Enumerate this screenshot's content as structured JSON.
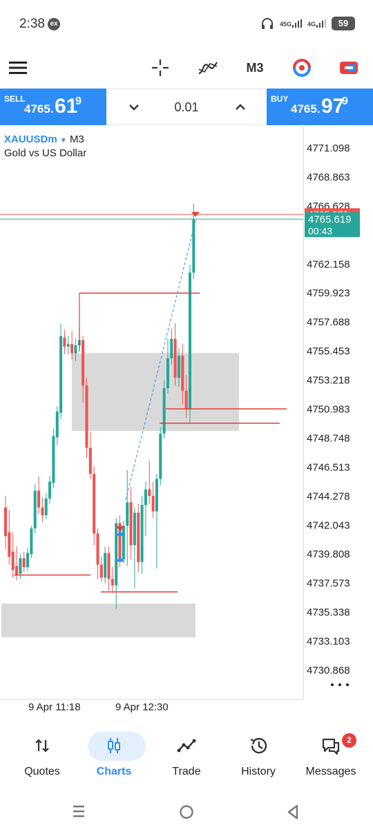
{
  "status_bar": {
    "time": "2:38",
    "ex_badge": "ex",
    "signal_1": "45G",
    "signal_2": "4G",
    "battery": "59"
  },
  "toolbar": {
    "timeframe": "M3",
    "icons": [
      "menu-icon",
      "crosshair-icon",
      "indicators-icon",
      "timeframe-label",
      "one-click-trading-icon",
      "chart-settings-icon"
    ]
  },
  "trade": {
    "sell_label": "SELL",
    "sell_price_small": "4765.",
    "sell_price_big": "61",
    "sell_price_sup": "9",
    "buy_label": "BUY",
    "buy_price_small": "4765.",
    "buy_price_big": "97",
    "buy_price_sup": "9",
    "lot": "0.01"
  },
  "chart": {
    "symbol": "XAUUSDm",
    "timeframe": "M3",
    "description": "Gold vs US Dollar",
    "current_price": "4765.619",
    "countdown": "00:43",
    "ask_price_partial": "4765.979",
    "colors": {
      "bull": "#26a69a",
      "bear": "#ef5350",
      "level": "#e53935",
      "zone": "#d9d9d9",
      "bid_label": "#26a69a",
      "ask_label": "#ef5350",
      "trend": "#2d8cf5"
    },
    "time_labels": [
      "9 Apr 11:18",
      "9 Apr 12:30"
    ]
  },
  "chart_data": {
    "type": "candlestick",
    "symbol": "XAUUSDm",
    "price_axis_ticks": [
      "4771.098",
      "4768.863",
      "4766.628",
      "4762.158",
      "4759.923",
      "4757.688",
      "4755.453",
      "4753.218",
      "4750.983",
      "4748.748",
      "4746.513",
      "4744.278",
      "4742.043",
      "4739.808",
      "4737.573",
      "4735.338",
      "4733.103",
      "4730.868"
    ],
    "ylim": [
      4730.868,
      4771.098
    ],
    "x_labels": [
      "9 Apr 11:18",
      "9 Apr 12:30"
    ],
    "last_price": 4765.619,
    "ask_price": 4765.979,
    "candles": [
      {
        "o": 4743.4,
        "h": 4744.3,
        "c": 4741.2,
        "l": 4740.2
      },
      {
        "o": 4741.5,
        "h": 4743.2,
        "c": 4739.6,
        "l": 4739.0
      },
      {
        "o": 4740.0,
        "h": 4741.5,
        "c": 4738.6,
        "l": 4738.0
      },
      {
        "o": 4738.9,
        "h": 4740.4,
        "c": 4738.2,
        "l": 4737.8
      },
      {
        "o": 4738.3,
        "h": 4739.8,
        "c": 4739.5,
        "l": 4737.9
      },
      {
        "o": 4739.5,
        "h": 4740.0,
        "c": 4738.8,
        "l": 4738.4
      },
      {
        "o": 4738.8,
        "h": 4740.3,
        "c": 4739.9,
        "l": 4738.5
      },
      {
        "o": 4739.8,
        "h": 4742.0,
        "c": 4741.8,
        "l": 4739.5
      },
      {
        "o": 4741.8,
        "h": 4745.2,
        "c": 4744.7,
        "l": 4741.4
      },
      {
        "o": 4744.7,
        "h": 4745.8,
        "c": 4743.4,
        "l": 4742.9
      },
      {
        "o": 4743.4,
        "h": 4744.2,
        "c": 4742.8,
        "l": 4742.3
      },
      {
        "o": 4742.8,
        "h": 4744.5,
        "c": 4744.1,
        "l": 4742.5
      },
      {
        "o": 4744.1,
        "h": 4745.8,
        "c": 4745.4,
        "l": 4743.7
      },
      {
        "o": 4745.3,
        "h": 4749.5,
        "c": 4748.9,
        "l": 4744.9
      },
      {
        "o": 4748.8,
        "h": 4751.2,
        "c": 4750.8,
        "l": 4748.2
      },
      {
        "o": 4750.7,
        "h": 4757.6,
        "c": 4756.6,
        "l": 4750.2
      },
      {
        "o": 4756.5,
        "h": 4757.1,
        "c": 4755.8,
        "l": 4755.2
      },
      {
        "o": 4755.8,
        "h": 4756.6,
        "c": 4756.0,
        "l": 4755.2
      },
      {
        "o": 4756.0,
        "h": 4757.0,
        "c": 4755.3,
        "l": 4754.8
      },
      {
        "o": 4755.3,
        "h": 4756.4,
        "c": 4755.9,
        "l": 4754.7
      },
      {
        "o": 4755.9,
        "h": 4757.3,
        "c": 4756.3,
        "l": 4755.4
      },
      {
        "o": 4756.3,
        "h": 4756.6,
        "c": 4752.8,
        "l": 4751.5
      },
      {
        "o": 4752.8,
        "h": 4753.4,
        "c": 4748.0,
        "l": 4747.2
      },
      {
        "o": 4748.0,
        "h": 4749.2,
        "c": 4746.0,
        "l": 4745.6
      },
      {
        "o": 4746.0,
        "h": 4746.6,
        "c": 4741.4,
        "l": 4740.5
      },
      {
        "o": 4741.4,
        "h": 4741.8,
        "c": 4739.0,
        "l": 4737.9
      },
      {
        "o": 4739.0,
        "h": 4739.6,
        "c": 4738.0,
        "l": 4737.7
      },
      {
        "o": 4738.0,
        "h": 4740.4,
        "c": 4739.9,
        "l": 4737.6
      },
      {
        "o": 4739.9,
        "h": 4740.4,
        "c": 4737.9,
        "l": 4737.0
      },
      {
        "o": 4737.9,
        "h": 4738.8,
        "c": 4737.4,
        "l": 4736.8
      },
      {
        "o": 4737.4,
        "h": 4742.6,
        "c": 4742.2,
        "l": 4735.6
      },
      {
        "o": 4742.2,
        "h": 4742.8,
        "c": 4739.4,
        "l": 4738.8
      },
      {
        "o": 4739.4,
        "h": 4742.4,
        "c": 4742.0,
        "l": 4739.1
      },
      {
        "o": 4742.0,
        "h": 4746.3,
        "c": 4743.8,
        "l": 4738.9
      },
      {
        "o": 4743.8,
        "h": 4745.0,
        "c": 4740.5,
        "l": 4739.4
      },
      {
        "o": 4740.5,
        "h": 4743.4,
        "c": 4743.0,
        "l": 4737.2
      },
      {
        "o": 4743.0,
        "h": 4743.7,
        "c": 4739.2,
        "l": 4738.4
      },
      {
        "o": 4739.2,
        "h": 4744.3,
        "c": 4743.6,
        "l": 4738.3
      },
      {
        "o": 4743.6,
        "h": 4745.4,
        "c": 4744.8,
        "l": 4741.2
      },
      {
        "o": 4744.8,
        "h": 4747.0,
        "c": 4744.3,
        "l": 4743.7
      },
      {
        "o": 4744.3,
        "h": 4745.4,
        "c": 4743.1,
        "l": 4742.6
      },
      {
        "o": 4743.1,
        "h": 4746.0,
        "c": 4745.6,
        "l": 4738.7
      },
      {
        "o": 4745.6,
        "h": 4749.6,
        "c": 4749.1,
        "l": 4745.1
      },
      {
        "o": 4749.1,
        "h": 4753.2,
        "c": 4752.6,
        "l": 4748.7
      },
      {
        "o": 4752.6,
        "h": 4756.4,
        "c": 4754.9,
        "l": 4752.2
      },
      {
        "o": 4754.9,
        "h": 4757.2,
        "c": 4756.4,
        "l": 4754.4
      },
      {
        "o": 4756.4,
        "h": 4757.6,
        "c": 4753.4,
        "l": 4752.8
      },
      {
        "o": 4753.4,
        "h": 4755.7,
        "c": 4755.1,
        "l": 4752.7
      },
      {
        "o": 4755.1,
        "h": 4756.0,
        "c": 4752.4,
        "l": 4751.3
      },
      {
        "o": 4752.4,
        "h": 4753.6,
        "c": 4751.0,
        "l": 4750.3
      },
      {
        "o": 4751.0,
        "h": 4762.1,
        "c": 4761.5,
        "l": 4749.9
      },
      {
        "o": 4761.5,
        "h": 4766.8,
        "c": 4765.6,
        "l": 4761.0
      }
    ],
    "horizontal_levels": [
      4759.923,
      4751.0,
      4749.9,
      4738.2,
      4736.9
    ],
    "zones": [
      {
        "top": 4755.3,
        "bottom": 4749.3
      },
      {
        "top": 4736.0,
        "bottom": 4733.4
      }
    ]
  },
  "bottom_nav": {
    "items": [
      {
        "label": "Quotes",
        "icon": "quotes-icon"
      },
      {
        "label": "Charts",
        "icon": "charts-icon"
      },
      {
        "label": "Trade",
        "icon": "trade-icon"
      },
      {
        "label": "History",
        "icon": "history-icon"
      },
      {
        "label": "Messages",
        "icon": "messages-icon"
      }
    ],
    "active": "Charts",
    "messages_badge": "2"
  }
}
